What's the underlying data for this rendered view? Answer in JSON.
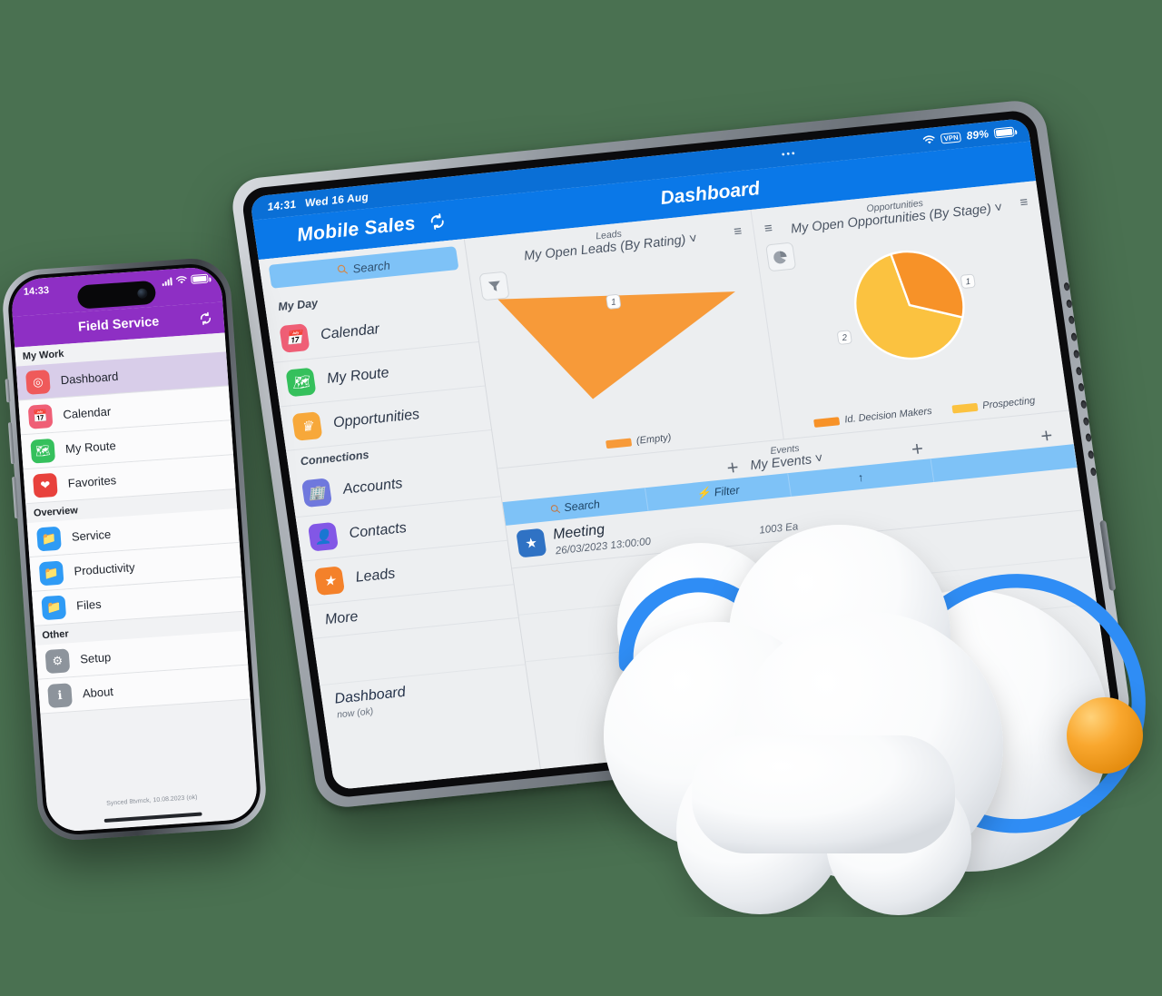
{
  "background_color": "#4a7151",
  "tablet": {
    "status_bar": {
      "time": "14:31",
      "date": "Wed 16 Aug",
      "dots": "•••",
      "vpn": "VPN",
      "battery_percent": "89%"
    },
    "nav": {
      "app_title": "Mobile Sales",
      "refresh_icon": "refresh-icon",
      "page_title": "Dashboard"
    },
    "sidebar": {
      "search_placeholder": "Search",
      "groups": [
        {
          "title": "My Day",
          "items": [
            {
              "label": "Calendar",
              "icon": "calendar-icon",
              "color": "#ef5f76"
            },
            {
              "label": "My Route",
              "icon": "route-map-icon",
              "color": "#35c05c"
            },
            {
              "label": "Opportunities",
              "icon": "crown-icon",
              "color": "#f7a83a"
            }
          ]
        },
        {
          "title": "Connections",
          "items": [
            {
              "label": "Accounts",
              "icon": "building-icon",
              "color": "#6f78dd"
            },
            {
              "label": "Contacts",
              "icon": "contact-card-icon",
              "color": "#8257e6"
            },
            {
              "label": "Leads",
              "icon": "lead-icon",
              "color": "#f4812a"
            }
          ]
        }
      ],
      "more_label": "More",
      "bottom_label": "Dashboard",
      "bottom_sub": "now (ok)"
    },
    "widgets": [
      {
        "subtitle": "Leads",
        "title": "My Open Leads (By Rating)",
        "chevron": "chevron-down-icon",
        "tool_icon": "funnel-icon",
        "list_icon": "list-icon"
      },
      {
        "subtitle": "Opportunities",
        "title": "My Open Opportunities (By Stage)",
        "chevron": "chevron-down-icon",
        "tool_icon": "pie-chart-icon",
        "list_icon": "list-icon"
      }
    ],
    "events": {
      "subtitle": "Events",
      "title": "My Events",
      "chevron": "chevron-down-icon",
      "add_icon": "plus-icon",
      "toolbar": {
        "search_label": "Search",
        "filter_label": "Filter",
        "sort_icon": "sort-ascending-icon"
      },
      "rows": [
        {
          "icon": "event-calendar-icon",
          "title": "Meeting",
          "datetime": "26/03/2023 13:00:00",
          "location": "1003 Ea"
        }
      ]
    }
  },
  "phone": {
    "status_bar": {
      "time": "14:33",
      "signal_icon": "cellular-icon",
      "wifi_icon": "wifi-icon",
      "battery_icon": "battery-icon"
    },
    "nav": {
      "title": "Field Service",
      "refresh_icon": "refresh-icon"
    },
    "groups": [
      {
        "title": "My Work",
        "items": [
          {
            "label": "Dashboard",
            "icon": "dashboard-target-icon",
            "color": "#ef5a5a",
            "selected": true
          },
          {
            "label": "Calendar",
            "icon": "calendar-icon",
            "color": "#ef5f76",
            "selected": false
          },
          {
            "label": "My Route",
            "icon": "route-map-icon",
            "color": "#35c05c",
            "selected": false
          },
          {
            "label": "Favorites",
            "icon": "heart-icon",
            "color": "#e8413c",
            "selected": false
          }
        ]
      },
      {
        "title": "Overview",
        "items": [
          {
            "label": "Service",
            "icon": "folder-icon",
            "color": "#2f9bf5",
            "selected": false
          },
          {
            "label": "Productivity",
            "icon": "folder-icon",
            "color": "#2f9bf5",
            "selected": false
          },
          {
            "label": "Files",
            "icon": "folder-icon",
            "color": "#2f9bf5",
            "selected": false
          }
        ]
      },
      {
        "title": "Other",
        "items": [
          {
            "label": "Setup",
            "icon": "gear-icon",
            "color": "#8d949c",
            "selected": false
          },
          {
            "label": "About",
            "icon": "info-icon",
            "color": "#8d949c",
            "selected": false
          }
        ]
      }
    ],
    "footer": "Synced 8tvmck, 10.08.2023 (ok)"
  },
  "chart_data": [
    {
      "type": "pie",
      "title": "My Open Leads (By Rating)",
      "subtitle": "Leads",
      "categories": [
        "(Empty)"
      ],
      "values": [
        100
      ],
      "labels": [
        "1"
      ],
      "colors": [
        "#f79a39"
      ],
      "legend_position": "bottom",
      "note": "Single 100% slice rendered as an angular wedge"
    },
    {
      "type": "pie",
      "title": "My Open Opportunities (By Stage)",
      "subtitle": "Opportunities",
      "categories": [
        "Id. Decision Makers",
        "Prospecting"
      ],
      "values": [
        33,
        67
      ],
      "labels": [
        "1",
        "2"
      ],
      "colors": [
        "#f79228",
        "#fbc council",
        "#fbc council"
      ],
      "legend_position": "bottom"
    }
  ],
  "cloud": {
    "name": "cloud-3d-illustration",
    "arc_color": "#2f8df5",
    "orb_color": "#f9a52a",
    "body_color": "#ffffff"
  }
}
